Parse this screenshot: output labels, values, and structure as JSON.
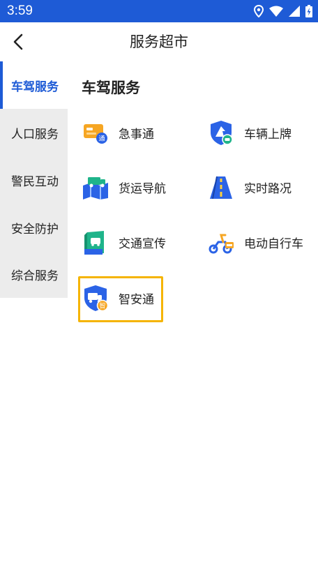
{
  "status_bar": {
    "time": "3:59",
    "icons": [
      "location-icon",
      "wifi-icon",
      "signal-icon",
      "battery-icon"
    ]
  },
  "header": {
    "title": "服务超市",
    "back_icon": "back-arrow-icon"
  },
  "sidebar": {
    "items": [
      {
        "label": "车驾服务",
        "active": true
      },
      {
        "label": "人口服务",
        "active": false
      },
      {
        "label": "警民互动",
        "active": false
      },
      {
        "label": "安全防护",
        "active": false
      },
      {
        "label": "综合服务",
        "active": false
      }
    ]
  },
  "main": {
    "section_title": "车驾服务",
    "services": [
      {
        "label": "急事通",
        "icon": "urgent-card-icon"
      },
      {
        "label": "车辆上牌",
        "icon": "vehicle-plate-shield-icon"
      },
      {
        "label": "货运导航",
        "icon": "freight-truck-map-icon"
      },
      {
        "label": "实时路况",
        "icon": "road-icon"
      },
      {
        "label": "交通宣传",
        "icon": "traffic-book-icon"
      },
      {
        "label": "电动自行车",
        "icon": "e-bike-icon"
      },
      {
        "label": "智安通",
        "icon": "smart-shield-truck-icon",
        "highlighted": true
      }
    ]
  },
  "colors": {
    "primary": "#1e5bd6",
    "highlight_border": "#f5b400",
    "sidebar_bg": "#ececec",
    "icon_orange": "#f6a623",
    "icon_blue": "#2b63e6",
    "icon_teal": "#1fb48a"
  }
}
